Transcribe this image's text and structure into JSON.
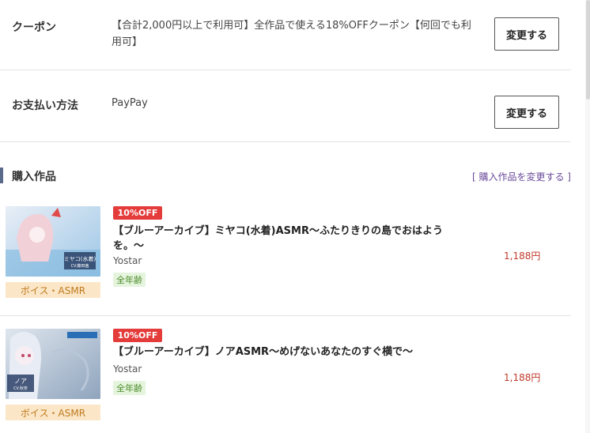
{
  "coupon": {
    "label": "クーポン",
    "value": "【合計2,000円以上で利用可】全作品で使える18%OFFクーポン【何回でも利用可】",
    "button": "変更する"
  },
  "payment": {
    "label": "お支払い方法",
    "value": "PayPay",
    "button": "変更する"
  },
  "purchase": {
    "title": "購入作品",
    "change_link": "[ 購入作品を変更する ]"
  },
  "products": [
    {
      "discount": "10%OFF",
      "title": "【ブルーアーカイブ】ミヤコ(水着)ASMR～ふたりきりの島でおはようを。～",
      "maker": "Yostar",
      "age": "全年齢",
      "genre": "ボイス・ASMR",
      "price": "1,188円",
      "thumb_text_1": "ミヤコ(水着)",
      "thumb_text_2": "CV.藤田茜"
    },
    {
      "discount": "10%OFF",
      "title": "【ブルーアーカイブ】ノアASMR～めげないあなたのすぐ横で～",
      "maker": "Yostar",
      "age": "全年齢",
      "genre": "ボイス・ASMR",
      "price": "1,188円",
      "thumb_text_1": "ノア",
      "thumb_text_2": "CV.秋奈"
    }
  ],
  "colors": {
    "discount_badge": "#e43b3b",
    "price": "#c0392b",
    "genre_bg": "#fbe7c8",
    "age_bg": "#e5f4dc",
    "section_bar": "#5a6a8a",
    "link": "#6a4a9a"
  }
}
